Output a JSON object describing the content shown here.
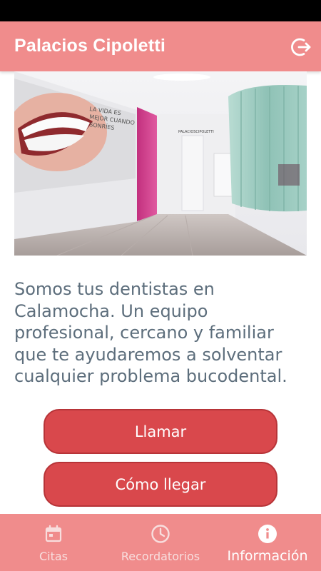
{
  "app_bar": {
    "title": "Palacios Cipoletti",
    "logout_icon": "logout-icon"
  },
  "hero": {
    "image": "clinic-hallway-photo",
    "wall_text": "LA VIDA ES MEJOR CUANDO SONRÍES",
    "sign_text": "PALACIOSCIPOLETTI"
  },
  "main": {
    "description": "Somos tus dentistas en Calamocha. Un equipo profesional, cercano y familiar que te ayudaremos a solventar cualquier problema bucodental.",
    "call_button": "Llamar",
    "directions_button": "Cómo llegar"
  },
  "bottom_nav": {
    "items": [
      {
        "label": "Citas",
        "icon": "calendar-icon",
        "active": false
      },
      {
        "label": "Recordatorios",
        "icon": "clock-icon",
        "active": false
      },
      {
        "label": "Información",
        "icon": "info-icon",
        "active": true
      }
    ]
  },
  "colors": {
    "primary": "#f08c8c",
    "button": "#d9484c",
    "text": "#5d6e7c"
  }
}
